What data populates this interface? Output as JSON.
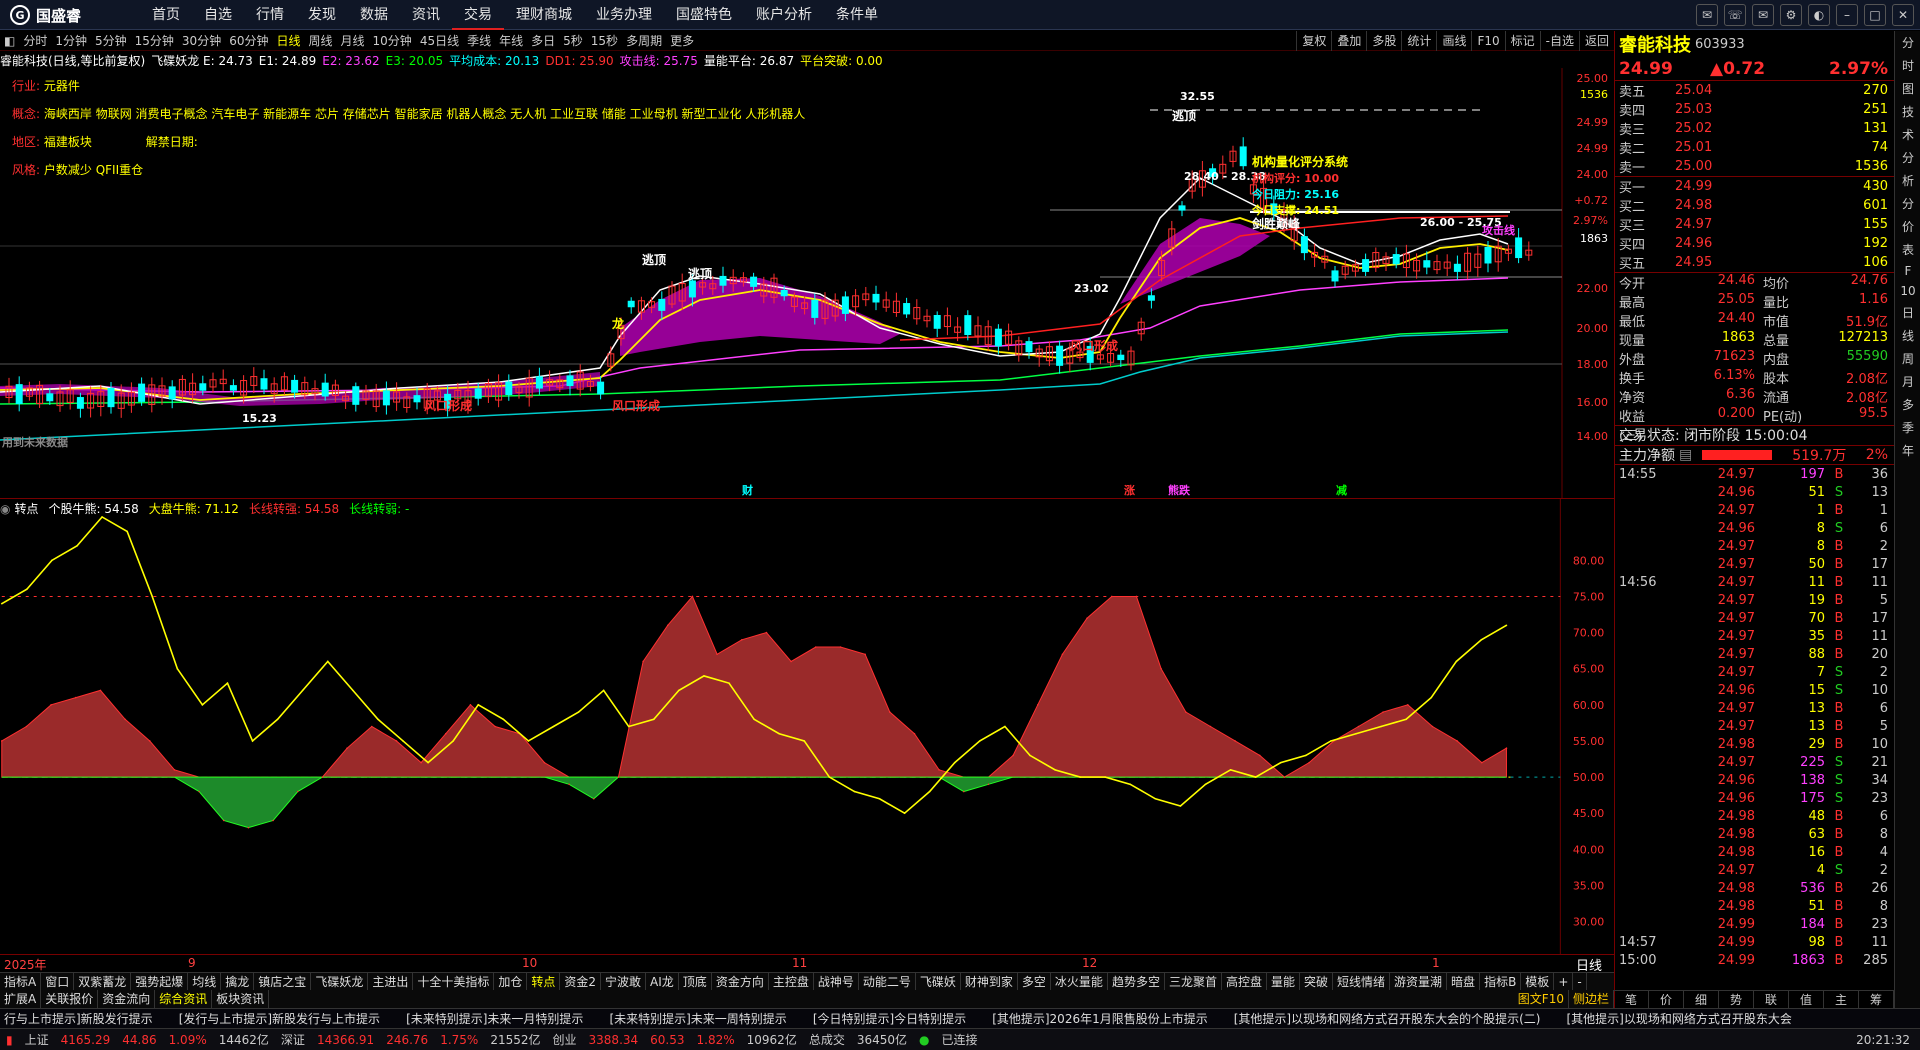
{
  "app": {
    "brand": "国盛睿",
    "nav": [
      "首页",
      "自选",
      "行情",
      "发现",
      "数据",
      "资讯",
      "交易",
      "理财商城",
      "业务办理",
      "国盛特色",
      "账户分析",
      "条件单"
    ],
    "nav_active": 6
  },
  "periods": [
    "分时",
    "1分钟",
    "5分钟",
    "15分钟",
    "30分钟",
    "60分钟",
    "日线",
    "周线",
    "月线",
    "10分钟",
    "45日线",
    "季线",
    "年线",
    "多日",
    "5秒",
    "15秒",
    "多周期",
    "更多"
  ],
  "period_selected": "日线",
  "chart_tools": [
    "复权",
    "叠加",
    "多股",
    "统计",
    "画线",
    "F10",
    "标记",
    "-自选",
    "返回"
  ],
  "legend_main": [
    {
      "t": "睿能科技(日线,等比前复权)",
      "c": "#ffffff"
    },
    {
      "t": "飞碟妖龙 E: 24.73",
      "c": "#ffffff"
    },
    {
      "t": "E1: 24.89",
      "c": "#ffffff"
    },
    {
      "t": "E2: 23.62",
      "c": "#ff40ff"
    },
    {
      "t": "E3: 20.05",
      "c": "#00ff00"
    },
    {
      "t": "平均成本: 20.13",
      "c": "#00ffff"
    },
    {
      "t": "DD1: 25.90",
      "c": "#ff3030"
    },
    {
      "t": "攻击线: 25.75",
      "c": "#ff40ff"
    },
    {
      "t": "量能平台: 26.87",
      "c": "#ffffff"
    },
    {
      "t": "平台突破: 0.00",
      "c": "#ffff00"
    }
  ],
  "info": {
    "industry_label": "行业:",
    "industry": "元器件",
    "concept_label": "概念:",
    "concept": "海峡西岸 物联网 消费电子概念 汽车电子 新能源车 芯片 存储芯片 智能家居 机器人概念 无人机 工业互联 储能 工业母机 新型工业化 人形机器人",
    "region_label": "地区:",
    "region": "福建板块",
    "unlock_label": "解禁日期:",
    "style_label": "风格:",
    "style": "户数减少 QFII重仓"
  },
  "price_axis": [
    "25.00",
    "24.99",
    "24.99",
    "24.00",
    "22.00",
    "20.00",
    "18.00",
    "16.00",
    "14.00"
  ],
  "price_axis_tags": {
    "p1": "1536",
    "p2": "+0.72",
    "p3": "2.97%",
    "p4": "1863"
  },
  "chart_annotations": {
    "high": "32.55",
    "escape1": "逃顶",
    "escape2": "逃顶",
    "escape3": "逃顶",
    "range1": "28.40 - 28.38",
    "range2": "26.00 - 25.75",
    "low_mark": "23.02",
    "low_mark2": "15.23",
    "quant_title": "机构量化评分系统",
    "quant_score": "机构评分: 10.00",
    "resist": "今日阻力: 25.16",
    "support": "今日支撑: 24.51",
    "gang": "剑胜巅峰",
    "wind1": "风口形成",
    "wind2": "风口形成",
    "wind3": "风口形成",
    "dragon": "龙",
    "attack": "攻击线",
    "notes": "财",
    "notes2": "涨",
    "notes3": "熊跌",
    "notes4": "减",
    "future": "用到未来数据"
  },
  "legend_ind": [
    {
      "t": "转点",
      "c": "#ffffff"
    },
    {
      "t": "个股牛熊: 54.58",
      "c": "#ffffff"
    },
    {
      "t": "大盘牛熊: 71.12",
      "c": "#ffff00"
    },
    {
      "t": "长线转强: 54.58",
      "c": "#ff3030"
    },
    {
      "t": "长线转弱: -",
      "c": "#00ff00"
    }
  ],
  "ind_axis": [
    "80.00",
    "75.00",
    "70.00",
    "65.00",
    "60.00",
    "55.00",
    "50.00",
    "45.00",
    "40.00",
    "35.00",
    "30.00"
  ],
  "chart_data": {
    "type": "line",
    "indicator": {
      "stock_bullbear": [
        55,
        57,
        60,
        61,
        62,
        58,
        55,
        51,
        48,
        44,
        43,
        44,
        48,
        50,
        54,
        57,
        55,
        52,
        56,
        60,
        57,
        56,
        52,
        49,
        47,
        50,
        66,
        71,
        75,
        67,
        69,
        70,
        66,
        68,
        68,
        67,
        59,
        56,
        51,
        48,
        49,
        53,
        60,
        67,
        72,
        75,
        75,
        65,
        59,
        57,
        55,
        53,
        50,
        52,
        55,
        57,
        59,
        60,
        57,
        55,
        52,
        54
      ],
      "market_bullbear": [
        74,
        76,
        80,
        82,
        86,
        84,
        75,
        65,
        60,
        63,
        55,
        58,
        62,
        66,
        62,
        58,
        55,
        52,
        55,
        60,
        58,
        55,
        57,
        59,
        62,
        57,
        58,
        62,
        64,
        63,
        58,
        56,
        55,
        50,
        48,
        47,
        45,
        48,
        52,
        55,
        57,
        53,
        51,
        50,
        50,
        49,
        47,
        46,
        49,
        51,
        50,
        52,
        53,
        55,
        56,
        57,
        58,
        61,
        66,
        69,
        71
      ]
    }
  },
  "date_axis": {
    "year": "2025年",
    "m9": "9",
    "m10": "10",
    "m11": "11",
    "m12": "12",
    "m1": "1",
    "tail": "日线"
  },
  "tabs": [
    "指标A",
    "窗口",
    "双紫蓄龙",
    "强势起爆",
    "均线",
    "擒龙",
    "镇店之宝",
    "飞碟妖龙",
    "主进出",
    "十全十美指标",
    "加仓",
    "转点",
    "资金2",
    "宁波敢",
    "AI龙",
    "顶底",
    "资金方向",
    "主控盘",
    "战神号",
    "动能二号",
    "飞碟妖",
    "财神到家",
    "多空",
    "冰火量能",
    "趋势多空",
    "三龙聚首",
    "高控盘",
    "量能",
    "突破",
    "短线情绪",
    "游资量潮",
    "暗盘",
    "指标B",
    "模板",
    "+",
    "-"
  ],
  "tab_selected": "转点",
  "tabs2": [
    "扩展A",
    "关联报价",
    "资金流向",
    "综合资讯",
    "板块资讯"
  ],
  "tab2_selected": "综合资讯",
  "tabs2_right": [
    "图文F10",
    "侧边栏"
  ],
  "ticker": [
    "行与上市提示]新股发行提示",
    "[发行与上市提示]新股发行与上市提示",
    "[未来特别提示]未来一月特别提示",
    "[未来特别提示]未来一周特别提示",
    "[今日特别提示]今日特别提示",
    "[其他提示]2026年1月限售股份上市提示",
    "[其他提示]以现场和网络方式召开股东大会的个股提示(二)",
    "[其他提示]以现场和网络方式召开股东大会"
  ],
  "status": {
    "sh": "上证",
    "sh_v": "4165.29",
    "sh_c": "44.86",
    "sh_p": "1.09%",
    "sh_a": "14462亿",
    "sz": "深证",
    "sz_v": "14366.91",
    "sz_c": "246.76",
    "sz_p": "1.75%",
    "sz_a": "21552亿",
    "cy": "创业",
    "cy_v": "3388.34",
    "cy_c": "60.53",
    "cy_p": "1.82%",
    "cy_a": "10962亿",
    "total": "总成交",
    "total_v": "36450亿",
    "conn": "已连接",
    "time": "20:21:32"
  },
  "quote": {
    "name": "睿能科技",
    "code": "603933",
    "price": "24.99",
    "chg": "▲0.72",
    "pct": "2.97%",
    "asks": [
      [
        "卖五",
        "25.04",
        "270"
      ],
      [
        "卖四",
        "25.03",
        "251"
      ],
      [
        "卖三",
        "25.02",
        "131"
      ],
      [
        "卖二",
        "25.01",
        "74"
      ],
      [
        "卖一",
        "25.00",
        "1536"
      ]
    ],
    "bids": [
      [
        "买一",
        "24.99",
        "430"
      ],
      [
        "买二",
        "24.98",
        "601"
      ],
      [
        "买三",
        "24.97",
        "155"
      ],
      [
        "买四",
        "24.96",
        "192"
      ],
      [
        "买五",
        "24.95",
        "106"
      ]
    ],
    "stats": [
      [
        "今开",
        "24.46",
        "均价",
        "24.76"
      ],
      [
        "最高",
        "25.05",
        "量比",
        "1.16"
      ],
      [
        "最低",
        "24.40",
        "市值",
        "51.9亿"
      ],
      [
        "现量",
        "1863",
        "总量",
        "127213"
      ],
      [
        "外盘",
        "71623",
        "内盘",
        "55590"
      ],
      [
        "换手",
        "6.13%",
        "股本",
        "2.08亿"
      ],
      [
        "净资",
        "6.36",
        "流通",
        "2.08亿"
      ],
      [
        "收益(三)",
        "0.200",
        "PE(动)",
        "95.5"
      ]
    ],
    "trade_state": "交易状态: 闭市阶段 15:00:04",
    "net_label": "主力净额",
    "net_val": "519.7万",
    "net_pct": "2%",
    "ticks": [
      [
        "14:55",
        "24.97",
        "197",
        "B",
        "36"
      ],
      [
        "",
        "24.96",
        "51",
        "S",
        "13"
      ],
      [
        "",
        "24.97",
        "1",
        "B",
        "1"
      ],
      [
        "",
        "24.96",
        "8",
        "S",
        "6"
      ],
      [
        "",
        "24.97",
        "8",
        "B",
        "2"
      ],
      [
        "",
        "24.97",
        "50",
        "B",
        "17"
      ],
      [
        "14:56",
        "24.97",
        "11",
        "B",
        "11"
      ],
      [
        "",
        "24.97",
        "19",
        "B",
        "5"
      ],
      [
        "",
        "24.97",
        "70",
        "B",
        "17"
      ],
      [
        "",
        "24.97",
        "35",
        "B",
        "11"
      ],
      [
        "",
        "24.97",
        "88",
        "B",
        "20"
      ],
      [
        "",
        "24.97",
        "7",
        "S",
        "2"
      ],
      [
        "",
        "24.96",
        "15",
        "S",
        "10"
      ],
      [
        "",
        "24.97",
        "13",
        "B",
        "6"
      ],
      [
        "",
        "24.97",
        "13",
        "B",
        "5"
      ],
      [
        "",
        "24.98",
        "29",
        "B",
        "10"
      ],
      [
        "",
        "24.97",
        "225",
        "S",
        "21"
      ],
      [
        "",
        "24.96",
        "138",
        "S",
        "34"
      ],
      [
        "",
        "24.96",
        "175",
        "S",
        "23"
      ],
      [
        "",
        "24.98",
        "48",
        "B",
        "6"
      ],
      [
        "",
        "24.98",
        "63",
        "B",
        "8"
      ],
      [
        "",
        "24.98",
        "16",
        "B",
        "4"
      ],
      [
        "",
        "24.97",
        "4",
        "S",
        "2"
      ],
      [
        "",
        "24.98",
        "536",
        "B",
        "26"
      ],
      [
        "",
        "24.98",
        "51",
        "B",
        "8"
      ],
      [
        "",
        "24.99",
        "184",
        "B",
        "23"
      ],
      [
        "14:57",
        "24.99",
        "98",
        "B",
        "11"
      ],
      [
        "15:00",
        "24.99",
        "1863",
        "B",
        "285"
      ]
    ],
    "bottom_tabs": [
      "笔",
      "价",
      "细",
      "势",
      "联",
      "值",
      "主",
      "筹"
    ]
  },
  "vtabs": [
    "分",
    "时",
    "图",
    "技",
    "术",
    "分",
    "析",
    "分",
    "价",
    "表",
    "F",
    "10",
    "日",
    "线",
    "周",
    "月",
    "多",
    "季",
    "年"
  ]
}
